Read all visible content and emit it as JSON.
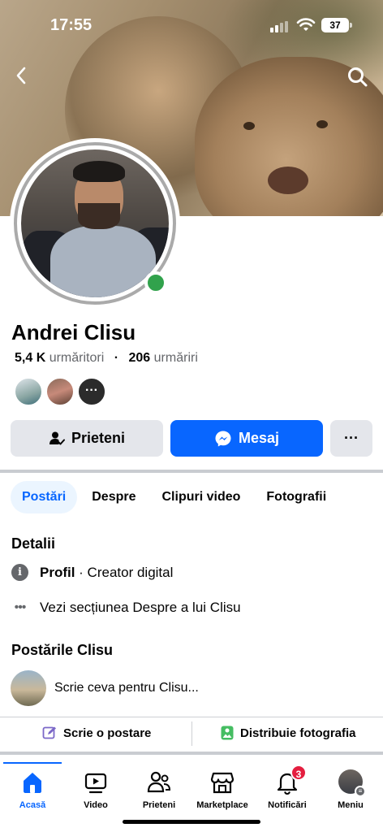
{
  "status_bar": {
    "time": "17:55",
    "battery": "37"
  },
  "profile": {
    "name": "Andrei Clisu",
    "followers_count": "5,4 K",
    "followers_label": "urmăritori",
    "following_count": "206",
    "following_label": "urmăriri",
    "friends_more": "···"
  },
  "actions": {
    "friends_label": "Prieteni",
    "message_label": "Mesaj",
    "more_label": "···"
  },
  "tabs": [
    {
      "label": "Postări",
      "active": true
    },
    {
      "label": "Despre",
      "active": false
    },
    {
      "label": "Clipuri video",
      "active": false
    },
    {
      "label": "Fotografii",
      "active": false
    }
  ],
  "details": {
    "heading": "Detalii",
    "profile_label": "Profil",
    "profile_value": " · Creator digital",
    "about_link": "Vezi secțiunea Despre a lui Clisu"
  },
  "posts": {
    "heading": "Postările Clisu",
    "compose_placeholder": "Scrie ceva pentru Clisu...",
    "write_post": "Scrie o postare",
    "share_photo": "Distribuie fotografia"
  },
  "bottom_nav": {
    "items": [
      {
        "label": "Acasă",
        "icon": "home-icon",
        "active": true
      },
      {
        "label": "Video",
        "icon": "video-icon",
        "active": false
      },
      {
        "label": "Prieteni",
        "icon": "friends-icon",
        "active": false
      },
      {
        "label": "Marketplace",
        "icon": "marketplace-icon",
        "active": false
      },
      {
        "label": "Notificări",
        "icon": "bell-icon",
        "active": false
      },
      {
        "label": "Meniu",
        "icon": "menu-avatar",
        "active": false
      }
    ],
    "notif_badge": "3"
  },
  "colors": {
    "accent": "#0866ff",
    "online": "#31a24c",
    "badge": "#e41e3f"
  }
}
